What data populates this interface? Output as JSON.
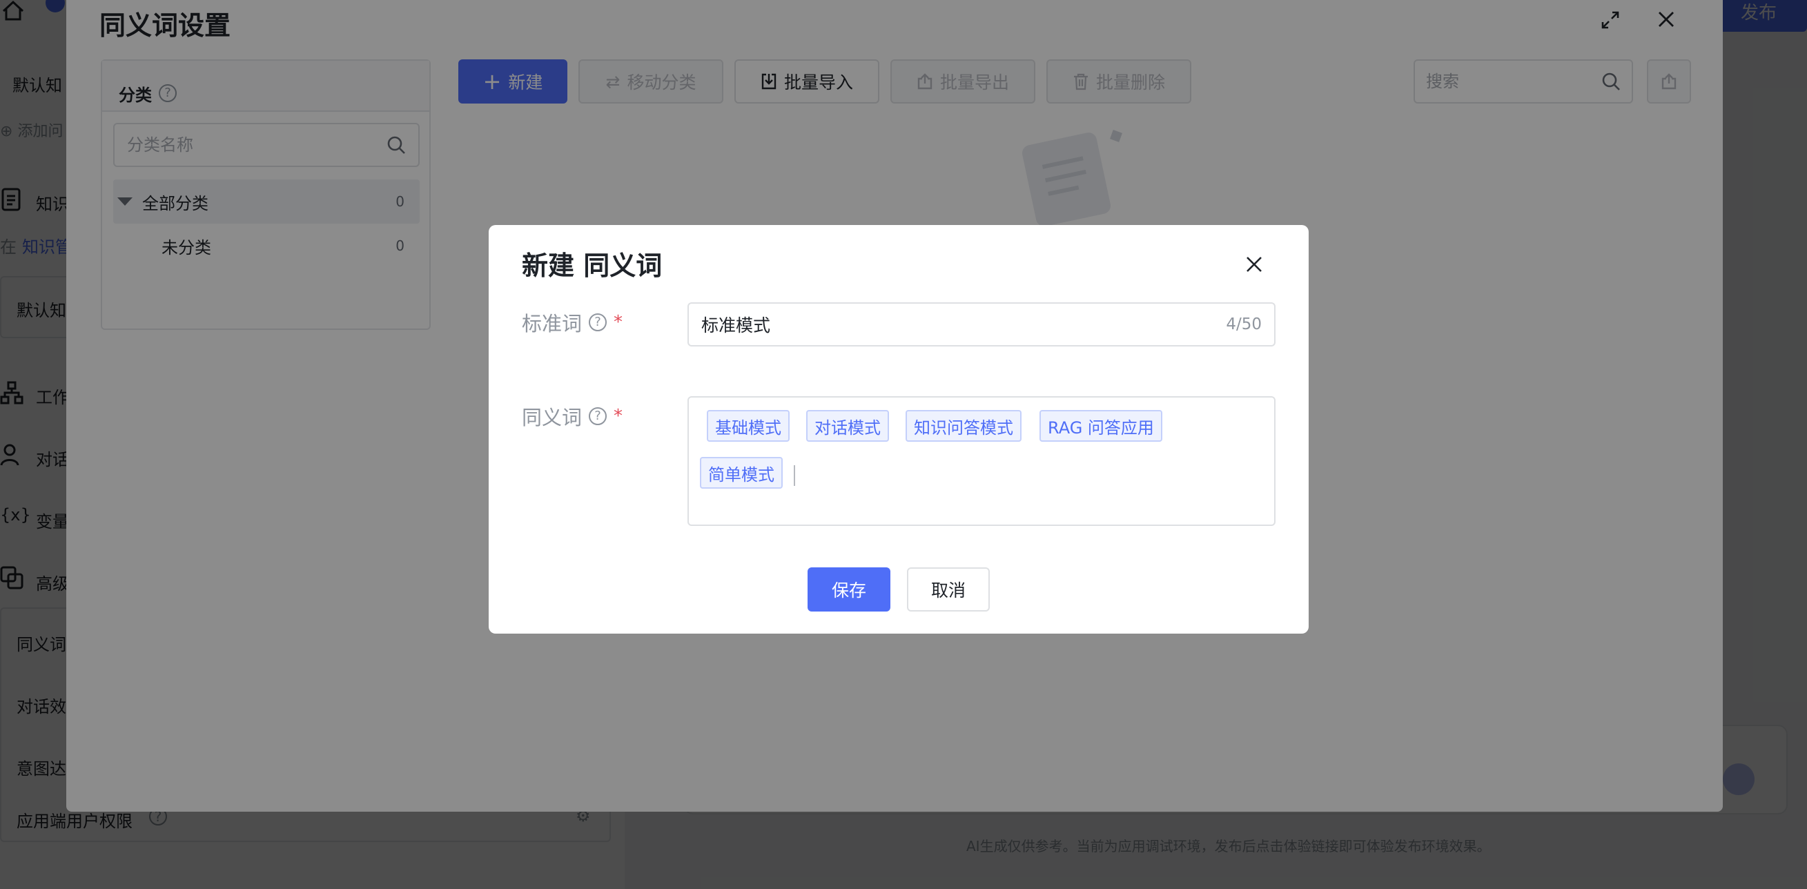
{
  "background": {
    "sidebar_items": [
      "默认知",
      "添加问",
      "知识",
      "在",
      "知识管",
      "默认知",
      "工作",
      "对话",
      "变量",
      "高级",
      "同义词",
      "对话效",
      "意图达",
      "应用端用户权限"
    ],
    "publish_label": "发布",
    "footer_text": "AI生成仅供参考。当前为应用调试环境，发布后点击体验链接即可体验发布环境效果。"
  },
  "synonym_settings": {
    "title": "同义词设置",
    "category_panel": {
      "header": "分类",
      "search_placeholder": "分类名称",
      "items": [
        {
          "label": "全部分类",
          "count": "0"
        },
        {
          "label": "未分类",
          "count": "0"
        }
      ]
    },
    "toolbar": {
      "new": "新建",
      "move": "移动分类",
      "import": "批量导入",
      "export": "批量导出",
      "delete": "批量删除"
    },
    "search_placeholder": "搜索"
  },
  "dialog": {
    "title": "新建 同义词",
    "standard_word_label": "标准词",
    "standard_word_value": "标准模式",
    "standard_word_counter": "4/50",
    "synonyms_label": "同义词",
    "synonym_tags": [
      "基础模式",
      "对话模式",
      "知识问答模式",
      "RAG 问答应用",
      "简单模式"
    ],
    "required_mark": "*",
    "help_mark": "?",
    "save_label": "保存",
    "cancel_label": "取消"
  },
  "colors": {
    "accent": "#4f6ef7",
    "required": "#e34d59",
    "tag_bg": "#eef2fe",
    "tag_border": "#c4d0fb"
  }
}
